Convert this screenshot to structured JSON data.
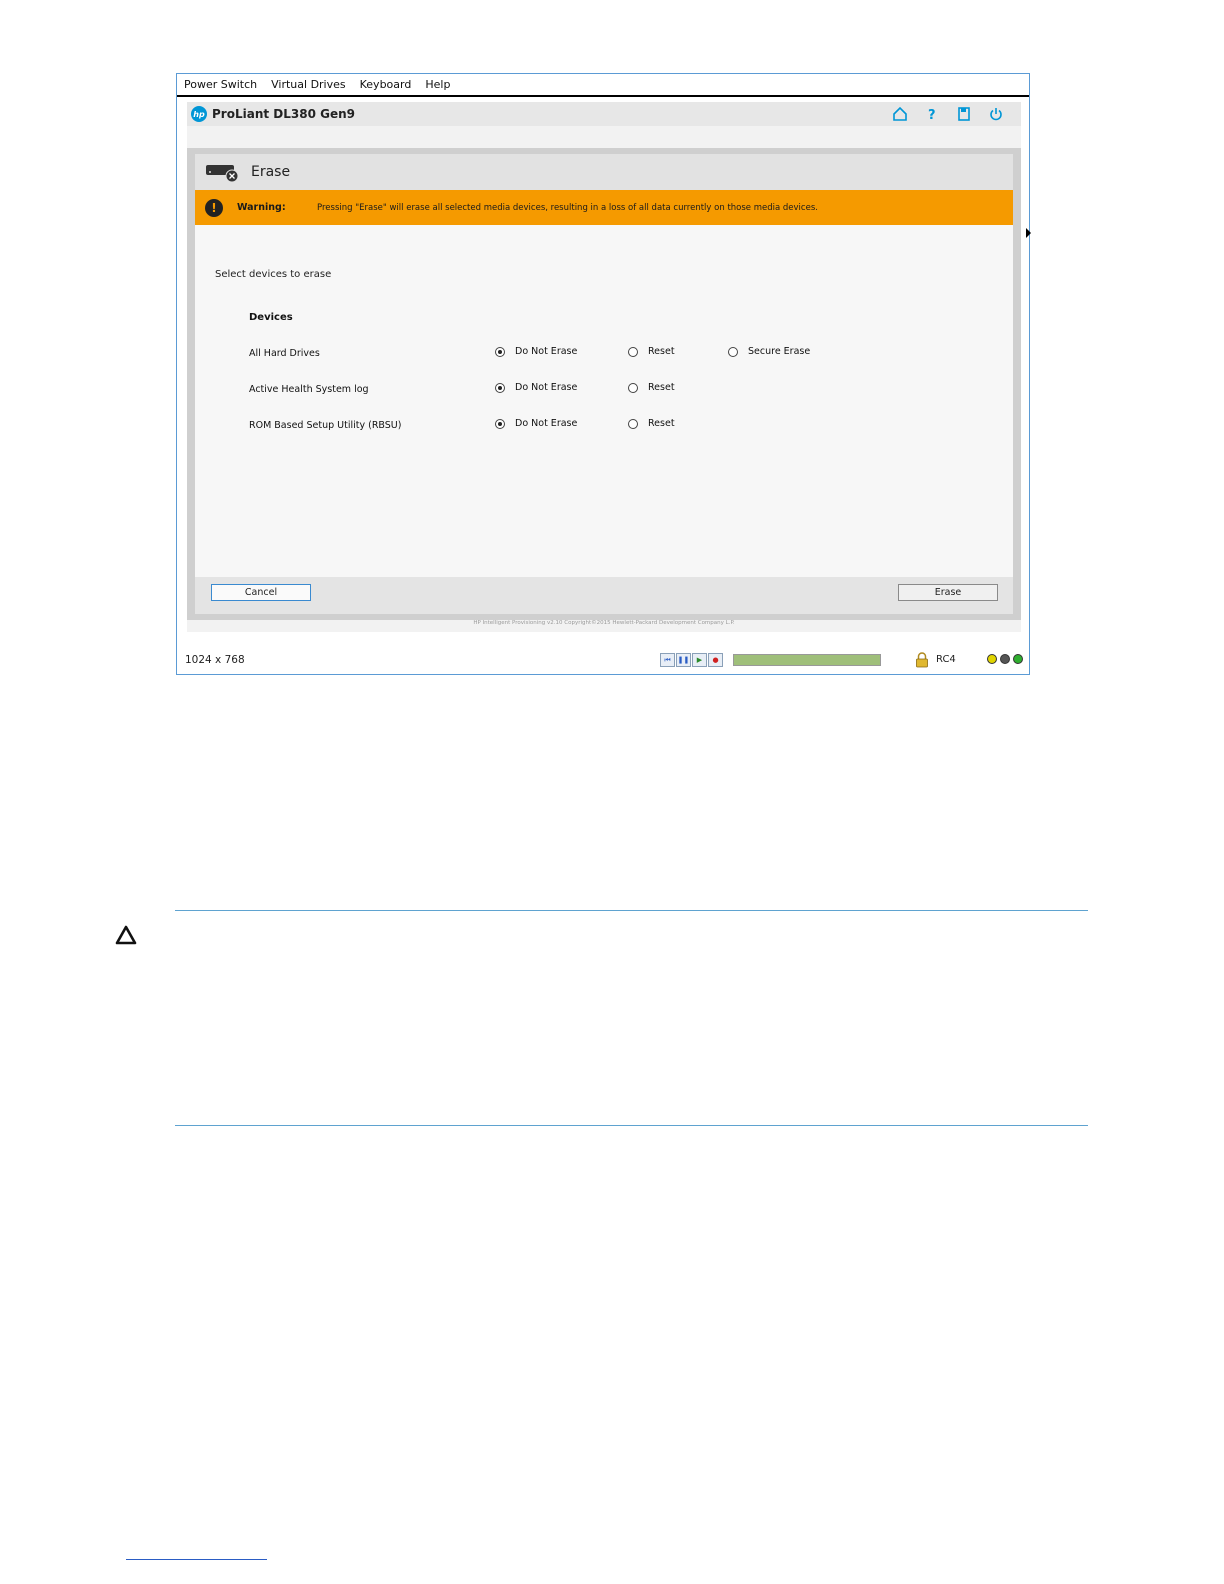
{
  "menubar": {
    "items": [
      "Power Switch",
      "Virtual Drives",
      "Keyboard",
      "Help"
    ]
  },
  "header": {
    "logo_text": "hp",
    "product_title": "ProLiant DL380 Gen9",
    "icons": [
      "home-icon",
      "help-icon",
      "save-icon",
      "power-icon"
    ]
  },
  "dialog": {
    "title": "Erase",
    "warning_label": "Warning:",
    "warning_text": "Pressing \"Erase\" will erase all selected media devices, resulting in a loss of all data currently on those media devices.",
    "instruction": "Select devices to erase",
    "devices_heading": "Devices",
    "devices": [
      {
        "name": "All Hard Drives",
        "options": [
          "Do Not Erase",
          "Reset",
          "Secure Erase"
        ],
        "selected": "Do Not Erase"
      },
      {
        "name": "Active Health System log",
        "options": [
          "Do Not Erase",
          "Reset"
        ],
        "selected": "Do Not Erase"
      },
      {
        "name": "ROM Based Setup Utility (RBSU)",
        "options": [
          "Do Not Erase",
          "Reset"
        ],
        "selected": "Do Not Erase"
      }
    ],
    "cancel_label": "Cancel",
    "erase_label": "Erase"
  },
  "copyright": "HP Intelligent Provisioning v2.10 Copyright©2015 Hewlett-Packard Development Company L.P.",
  "status_bar": {
    "resolution": "1024 x 768",
    "encryption": "RC4",
    "playback_buttons": [
      "skip-back-icon",
      "pause-icon",
      "play-icon",
      "record-icon"
    ],
    "progress_fraction": 1.0,
    "led_colors": [
      "#e0d400",
      "#555555",
      "#2fae2f"
    ]
  },
  "colors": {
    "warning_bg": "#f59a00",
    "accent_blue": "#0096d6",
    "rule_blue": "#5fa3d0"
  }
}
